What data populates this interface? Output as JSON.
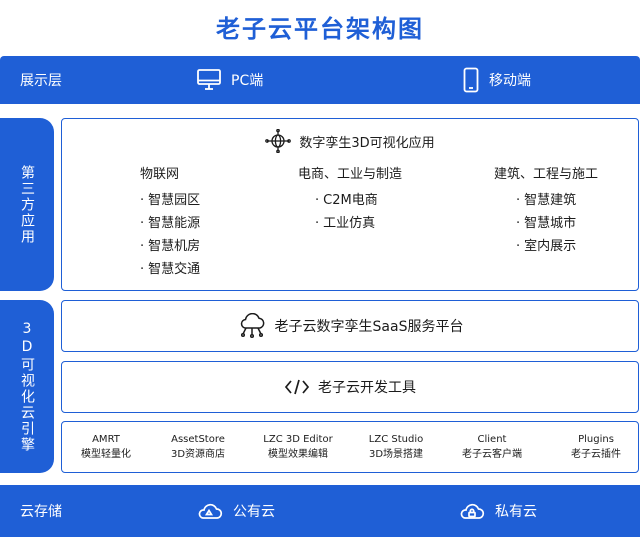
{
  "title": "老子云平台架构图",
  "display_layer": {
    "label": "展示层",
    "items": [
      {
        "label": "PC端",
        "icon": "monitor-icon"
      },
      {
        "label": "移动端",
        "icon": "mobile-icon"
      }
    ]
  },
  "third_party": {
    "side_label": "第三方应用",
    "header": "数字孪生3D可视化应用",
    "header_icon": "globe-network-icon",
    "columns": [
      {
        "title": "物联网",
        "items": [
          "智慧园区",
          "智慧能源",
          "智慧机房",
          "智慧交通"
        ]
      },
      {
        "title": "电商、工业与制造",
        "items": [
          "C2M电商",
          "工业仿真"
        ]
      },
      {
        "title": "建筑、工程与施工",
        "items": [
          "智慧建筑",
          "智慧城市",
          "室内展示"
        ]
      }
    ]
  },
  "engine": {
    "side_label": "3D可视化云引擎",
    "saas_label": "老子云数字孪生SaaS服务平台",
    "dev_label": "老子云开发工具",
    "tools": [
      {
        "name": "AMRT",
        "desc": "模型轻量化"
      },
      {
        "name": "AssetStore",
        "desc": "3D资源商店"
      },
      {
        "name": "LZC 3D Editor",
        "desc": "模型效果编辑"
      },
      {
        "name": "LZC Studio",
        "desc": "3D场景搭建"
      },
      {
        "name": "Client",
        "desc": "老子云客户端"
      },
      {
        "name": "Plugins",
        "desc": "老子云插件"
      }
    ]
  },
  "storage": {
    "label": "云存储",
    "items": [
      {
        "label": "公有云",
        "icon": "public-cloud-icon"
      },
      {
        "label": "私有云",
        "icon": "private-cloud-icon"
      }
    ]
  },
  "colors": {
    "primary": "#1f5fd6",
    "background": "#ffffff",
    "text": "#1c1c1c"
  }
}
